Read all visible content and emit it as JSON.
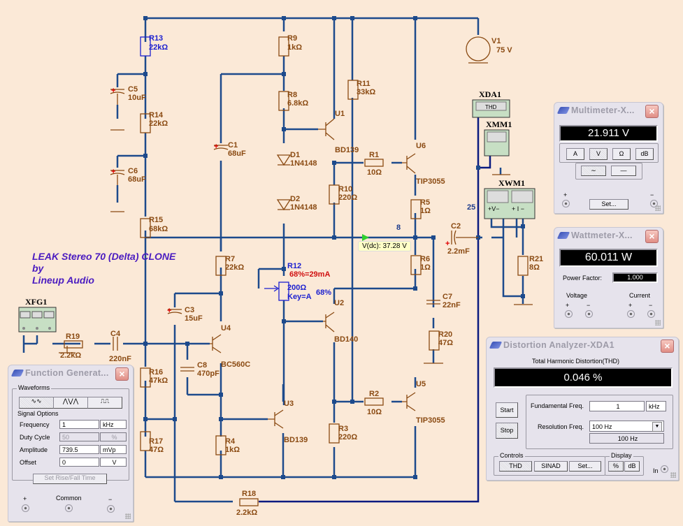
{
  "schematic": {
    "title_lines": [
      "LEAK Stereo 70 (Delta) CLONE",
      "by",
      "Lineup Audio"
    ],
    "probe": {
      "label": "V(dc): 37.28 V"
    },
    "net_labels": [
      "8",
      "25"
    ],
    "components": {
      "R13": {
        "name": "R13",
        "value": "22kΩ"
      },
      "R14": {
        "name": "R14",
        "value": "22kΩ"
      },
      "R15": {
        "name": "R15",
        "value": "68kΩ"
      },
      "R16": {
        "name": "R16",
        "value": "47kΩ"
      },
      "R17": {
        "name": "R17",
        "value": "47Ω"
      },
      "R18": {
        "name": "R18",
        "value": "2.2kΩ"
      },
      "R19": {
        "name": "R19",
        "value": "2.2kΩ"
      },
      "R9": {
        "name": "R9",
        "value": "1kΩ"
      },
      "R8": {
        "name": "R8",
        "value": "6.8kΩ"
      },
      "R7": {
        "name": "R7",
        "value": "22kΩ"
      },
      "R4": {
        "name": "R4",
        "value": "1kΩ"
      },
      "R11": {
        "name": "R11",
        "value": "33kΩ"
      },
      "R10": {
        "name": "R10",
        "value": "220Ω"
      },
      "R3": {
        "name": "R3",
        "value": "220Ω"
      },
      "R1": {
        "name": "R1",
        "value": "10Ω"
      },
      "R2": {
        "name": "R2",
        "value": "10Ω"
      },
      "R5": {
        "name": "R5",
        "value": "1Ω"
      },
      "R6": {
        "name": "R6",
        "value": "1Ω"
      },
      "R20": {
        "name": "R20",
        "value": "47Ω"
      },
      "R21": {
        "name": "R21",
        "value": "8Ω"
      },
      "R12": {
        "name": "R12",
        "setting": "68%=29mA",
        "value": "200Ω",
        "key": "Key=A",
        "percent": "68%"
      },
      "C1": {
        "name": "C1",
        "value": "68uF"
      },
      "C2": {
        "name": "C2",
        "value": "2.2mF"
      },
      "C3": {
        "name": "C3",
        "value": "15uF"
      },
      "C4": {
        "name": "C4",
        "value": "220nF"
      },
      "C5": {
        "name": "C5",
        "value": "10uF"
      },
      "C6": {
        "name": "C6",
        "value": "68uF"
      },
      "C7": {
        "name": "C7",
        "value": "22nF"
      },
      "C8": {
        "name": "C8",
        "value": "470pF"
      },
      "D1": {
        "name": "D1",
        "value": "1N4148"
      },
      "D2": {
        "name": "D2",
        "value": "1N4148"
      },
      "U1": {
        "name": "U1",
        "value": "BD139"
      },
      "U2": {
        "name": "U2",
        "value": "BD140"
      },
      "U3": {
        "name": "U3",
        "value": "BD139"
      },
      "U4": {
        "name": "U4",
        "value": "BC560C"
      },
      "U5": {
        "name": "U5",
        "value": "TIP3055"
      },
      "U6": {
        "name": "U6",
        "value": "TIP3055"
      },
      "V1": {
        "name": "V1",
        "value": "75 V"
      }
    },
    "instruments": {
      "XFG1": {
        "name": "XFG1"
      },
      "XDA1": {
        "name": "XDA1",
        "screen": "THD"
      },
      "XMM1": {
        "name": "XMM1"
      },
      "XWM1": {
        "name": "XWM1",
        "v_label": "+V−",
        "i_label": "+ I −"
      }
    }
  },
  "function_generator": {
    "title": "Function Generat...",
    "waveforms_caption": "Waveforms",
    "waveforms": [
      "sine",
      "triangle",
      "square"
    ],
    "selected_waveform": "sine",
    "signal_caption": "Signal Options",
    "rows": [
      {
        "label": "Frequency",
        "value": "1",
        "unit": "kHz",
        "disabled": false
      },
      {
        "label": "Duty Cycle",
        "value": "50",
        "unit": "%",
        "disabled": true
      },
      {
        "label": "Amplitude",
        "value": "739.5",
        "unit": "mVp",
        "disabled": false
      },
      {
        "label": "Offset",
        "value": "0",
        "unit": "V",
        "disabled": false
      }
    ],
    "rise_fall_button": "Set Rise/Fall Time",
    "terminals": {
      "plus": "+",
      "common": "Common",
      "minus": "−"
    }
  },
  "multimeter": {
    "title": "Multimeter-X...",
    "reading": "21.911 V",
    "modes": [
      "A",
      "V",
      "Ω",
      "dB"
    ],
    "selected_mode": "V",
    "signal_types": [
      "ac",
      "dc"
    ],
    "selected_signal": "ac",
    "set_button": "Set...",
    "terminals": {
      "plus": "+",
      "minus": "−"
    }
  },
  "wattmeter": {
    "title": "Wattmeter-X...",
    "reading": "60.011 W",
    "power_factor_label": "Power Factor:",
    "power_factor": "1.000",
    "voltage_label": "Voltage",
    "current_label": "Current",
    "plus": "+",
    "minus": "−"
  },
  "distortion_analyzer": {
    "title": "Distortion Analyzer-XDA1",
    "thd_caption": "Total Harmonic Distortion(THD)",
    "reading": "0.046 %",
    "start_button": "Start",
    "stop_button": "Stop",
    "fundamental_label": "Fundamental Freq.",
    "fundamental_value": "1",
    "fundamental_unit": "kHz",
    "resolution_label": "Resolution Freq.",
    "resolution_value": "100 Hz",
    "resolution_readout": "100 Hz",
    "controls_caption": "Controls",
    "controls": [
      "THD",
      "SINAD",
      "Set..."
    ],
    "selected_control": "THD",
    "display_caption": "Display",
    "display_modes": [
      "%",
      "dB"
    ],
    "selected_display": "%",
    "in_label": "In"
  }
}
